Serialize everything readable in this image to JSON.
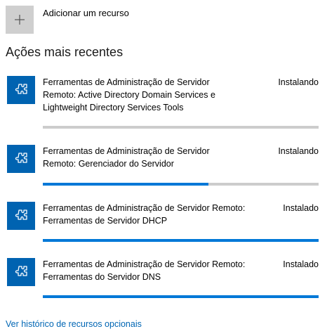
{
  "add_feature": {
    "label": "Adicionar um recurso",
    "icon": "plus-icon"
  },
  "recent": {
    "title": "Ações mais recentes",
    "items": [
      {
        "name_lines": [
          "Ferramentas de Administração de Servidor",
          "Remoto: Active Directory Domain Services e",
          "Lightweight Directory Services Tools"
        ],
        "status": "Instalando",
        "progress": 0.0,
        "icon": "puzzle-icon"
      },
      {
        "name_lines": [
          "Ferramentas de Administração de Servidor",
          "Remoto: Gerenciador do Servidor"
        ],
        "status": "Instalando",
        "progress": 0.6,
        "icon": "puzzle-icon"
      },
      {
        "name_lines": [
          "Ferramentas de Administração de Servidor Remoto:",
          "Ferramentas de Servidor DHCP"
        ],
        "status": "Instalado",
        "progress": 1.0,
        "icon": "puzzle-icon"
      },
      {
        "name_lines": [
          "Ferramentas de Administração de Servidor Remoto:",
          "Ferramentas do Servidor DNS"
        ],
        "status": "Instalado",
        "progress": 1.0,
        "icon": "puzzle-icon"
      }
    ]
  },
  "history_link": "Ver histórico de recursos opcionais",
  "colors": {
    "accent": "#0078d7",
    "icon_bg": "#0063b1",
    "bar_bg": "#cccccc",
    "link": "#0066b4"
  }
}
